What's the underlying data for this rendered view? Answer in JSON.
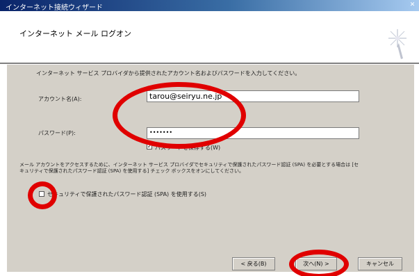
{
  "window": {
    "title": "インターネット接続ウィザード"
  },
  "header": {
    "title": "インターネット メール ログオン"
  },
  "instructions": "インターネット サービス プロバイダから提供されたアカウント名およびパスワードを入力してください。",
  "account": {
    "label": "アカウント名(A):",
    "value": "tarou@seiryu.ne.jp"
  },
  "password": {
    "label": "パスワード(P):",
    "value": "•••••••"
  },
  "remember_password": {
    "label": "パスワードを保存する(W)",
    "checked": true
  },
  "spa_note": "メール アカウントをアクセスするために、インターネット サービス プロバイダでセキュリティで保護されたパスワード認証 (SPA) を必要とする場合は [セキュリティで保護されたパスワード認証 (SPA) を使用する] チェック ボックスをオンにしてください。",
  "spa_checkbox": {
    "label": "セキュリティで保護されたパスワード認証 (SPA) を使用する(S)",
    "checked": false
  },
  "buttons": {
    "back": "< 戻る(B)",
    "next": "次へ(N) >",
    "cancel": "キャンセル"
  },
  "colors": {
    "titlebar": "#0a246a",
    "dialog": "#d4d0c8",
    "annotation": "#e00000"
  }
}
